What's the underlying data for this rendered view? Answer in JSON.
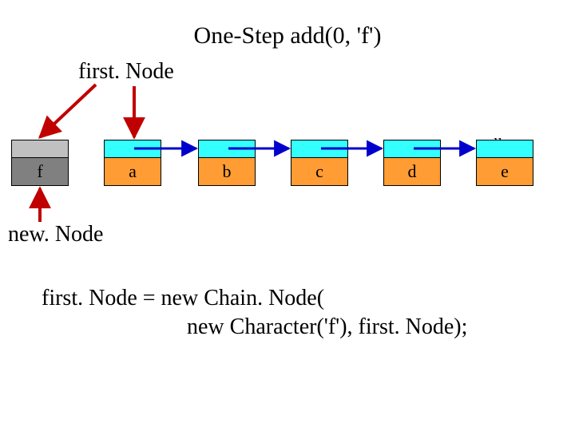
{
  "title": "One-Step add(0, 'f')",
  "labels": {
    "firstNode": "first. Node",
    "newNode": "new. Node",
    "null": "null"
  },
  "nodes": {
    "f": "f",
    "a": "a",
    "b": "b",
    "c": "c",
    "d": "d",
    "e": "e"
  },
  "code": {
    "line1": "first. Node = new Chain. Node(",
    "line2": "                          new Character('f'), first. Node);"
  },
  "colors": {
    "newNodePtr": "#c0c0c0",
    "newNodeData": "#808080",
    "chainPtr": "#33ffff",
    "chainData": "#ff9c33",
    "arrowRed": "#c00000",
    "arrowBlue": "#0000cc"
  }
}
